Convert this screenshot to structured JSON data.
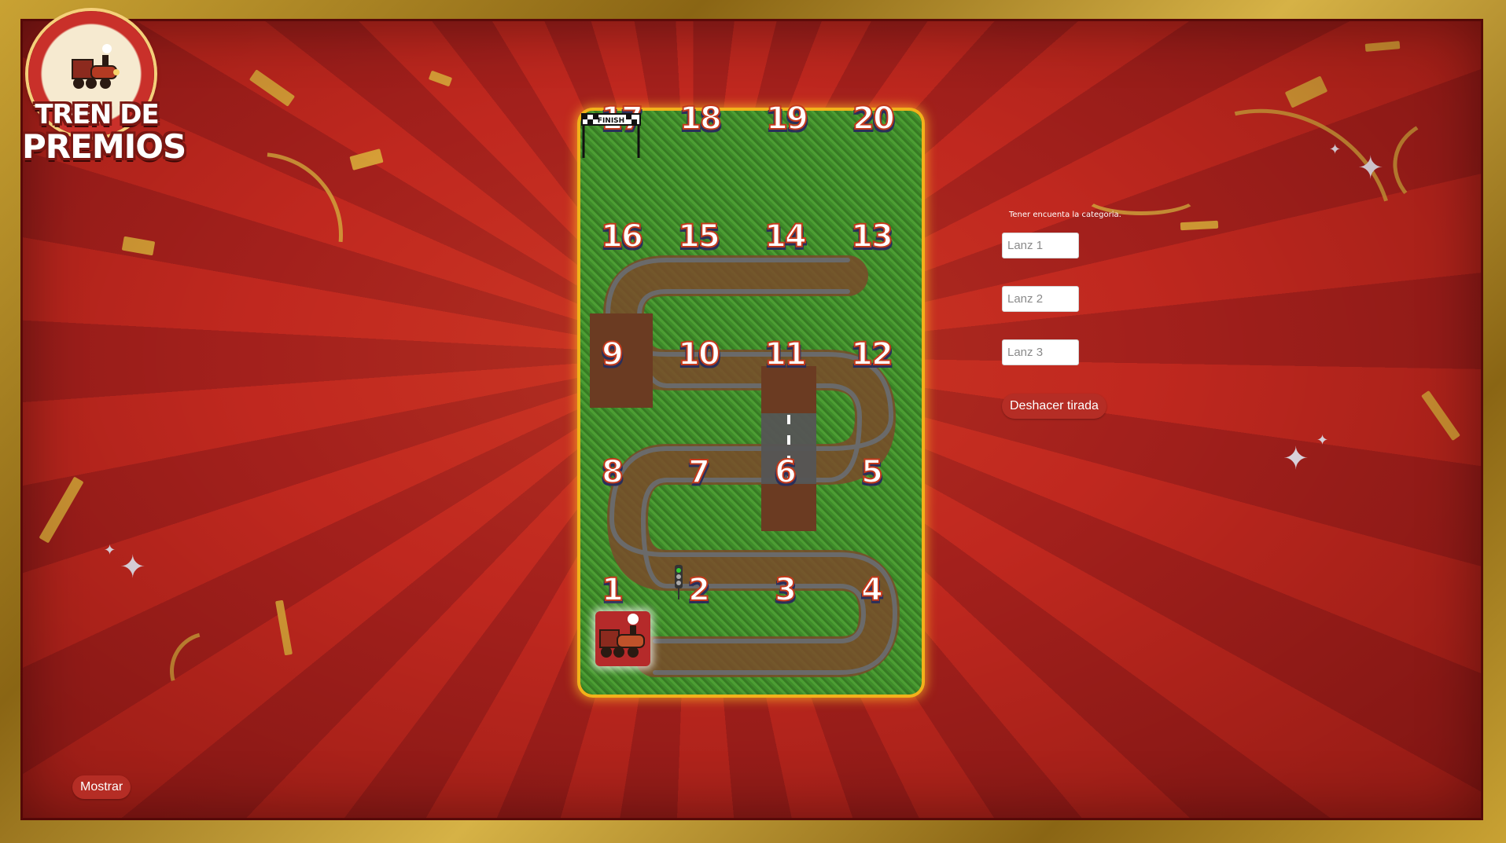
{
  "logo": {
    "line1": "TREN DE",
    "line2": "PREMIOS"
  },
  "board": {
    "numbers": [
      "1",
      "2",
      "3",
      "4",
      "5",
      "6",
      "7",
      "8",
      "9",
      "10",
      "11",
      "12",
      "13",
      "14",
      "15",
      "16",
      "17",
      "18",
      "19",
      "20"
    ],
    "finish_label": "FINISH",
    "current_position": "1"
  },
  "panel": {
    "hint": "Tener encuenta la categoria.",
    "lanz1_placeholder": "Lanz 1",
    "lanz2_placeholder": "Lanz 2",
    "lanz3_placeholder": "Lanz 3",
    "undo_label": "Deshacer tirada"
  },
  "footer": {
    "show_label": "Mostrar"
  },
  "colors": {
    "background": "#b52320",
    "frame": "#c9a233",
    "board_glow": "#f2b21a",
    "button": "#b52d25"
  }
}
